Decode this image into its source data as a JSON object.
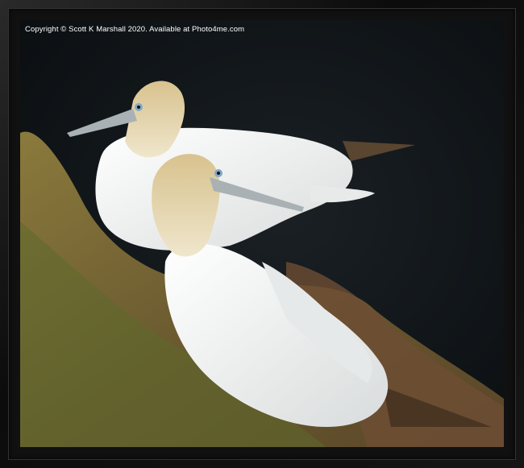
{
  "watermark": {
    "text": "Copyright  © Scott K Marshall  2020. Available at Photo4me.com"
  },
  "photo": {
    "subject": "gannets",
    "colors": {
      "background": "#0f1418",
      "feather": "#f2f2ef",
      "head": "#d9c391",
      "grass": "#7a6a3a",
      "frame": "#111111"
    }
  }
}
